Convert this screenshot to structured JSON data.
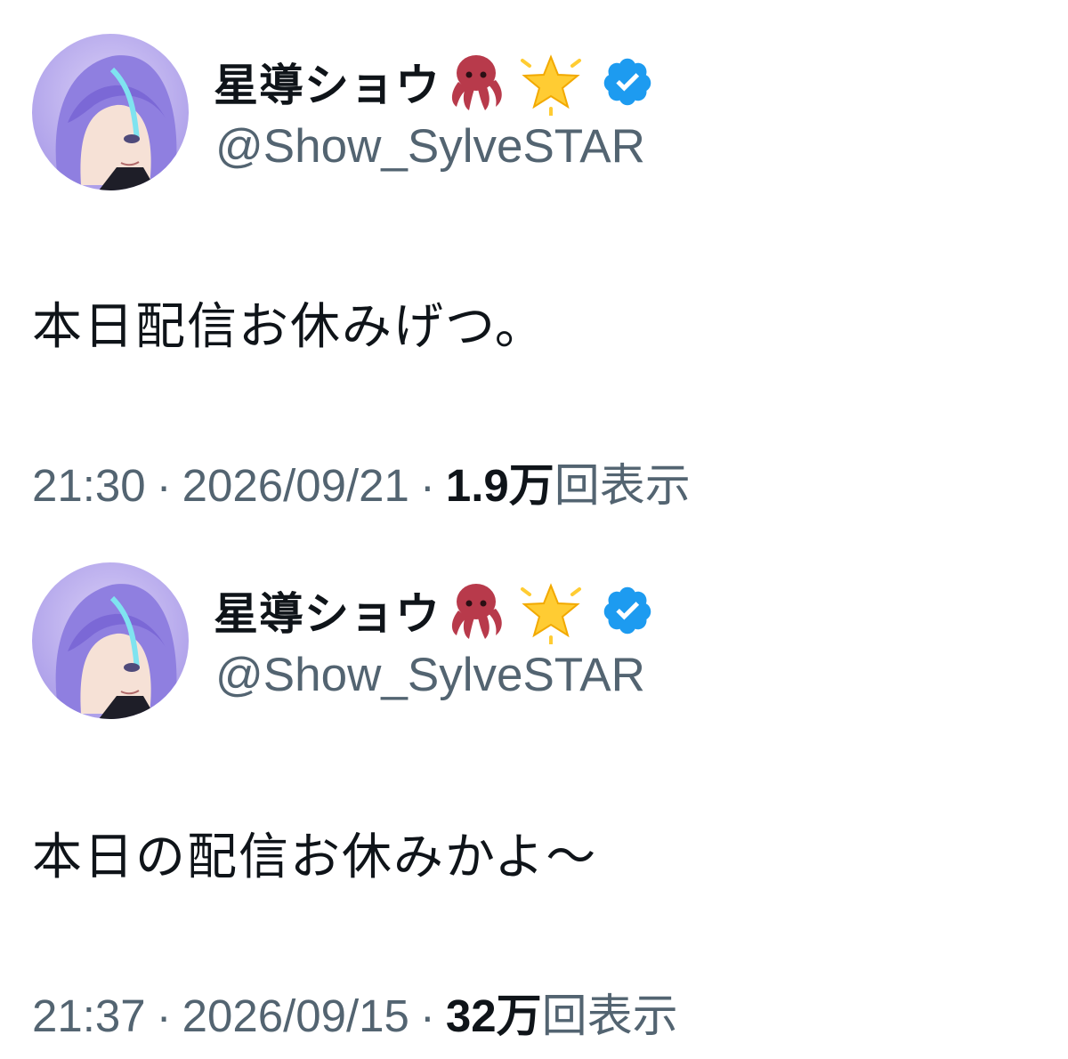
{
  "tweets": [
    {
      "author": {
        "display_name": "星導ショウ",
        "name_emojis": [
          "octopus-icon",
          "glowing-star-icon"
        ],
        "verified": true,
        "handle": "@Show_SylveSTAR"
      },
      "text": "本日配信お休みげつ。",
      "time": "21:30",
      "date": "2026/09/21",
      "views_count": "1.9万",
      "views_label": "回表示"
    },
    {
      "author": {
        "display_name": "星導ショウ",
        "name_emojis": [
          "octopus-icon",
          "glowing-star-icon"
        ],
        "verified": true,
        "handle": "@Show_SylveSTAR"
      },
      "text": "本日の配信お休みかよ〜",
      "time": "21:37",
      "date": "2026/09/15",
      "views_count": "32万",
      "views_label": "回表示"
    }
  ],
  "separator": "·",
  "colors": {
    "text_primary": "#0f1419",
    "text_secondary": "#536471",
    "verified_blue": "#1d9bf0",
    "avatar_hair": "#8f7fe0",
    "octopus_red": "#b83a4b",
    "star_yellow": "#ffcc33"
  }
}
